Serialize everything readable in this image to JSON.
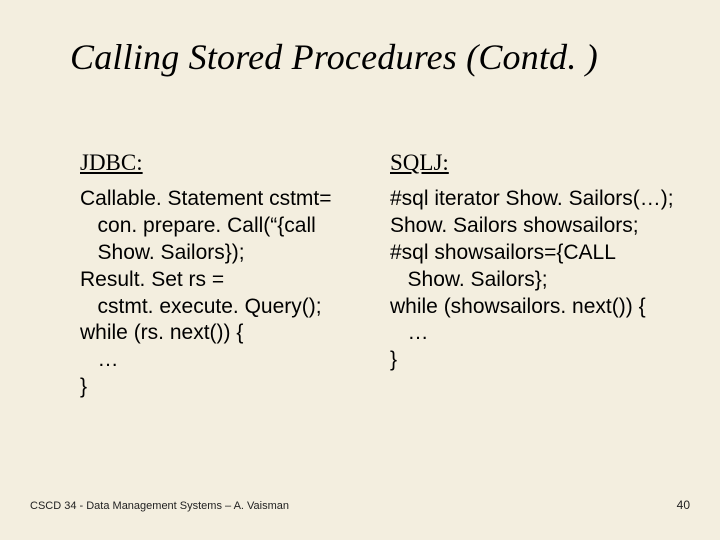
{
  "title": "Calling Stored Procedures (Contd. )",
  "left": {
    "heading": "JDBC:",
    "code": "Callable. Statement cstmt=\n   con. prepare. Call(“{call\n   Show. Sailors});\nResult. Set rs =\n   cstmt. execute. Query();\nwhile (rs. next()) {\n   …\n}"
  },
  "right": {
    "heading": "SQLJ:",
    "code": "#sql iterator Show. Sailors(…);\nShow. Sailors showsailors;\n#sql showsailors={CALL\n   Show. Sailors};\nwhile (showsailors. next()) {\n   …\n}"
  },
  "footer": {
    "left": "CSCD 34 - Data Management Systems – A. Vaisman",
    "right": "40"
  }
}
